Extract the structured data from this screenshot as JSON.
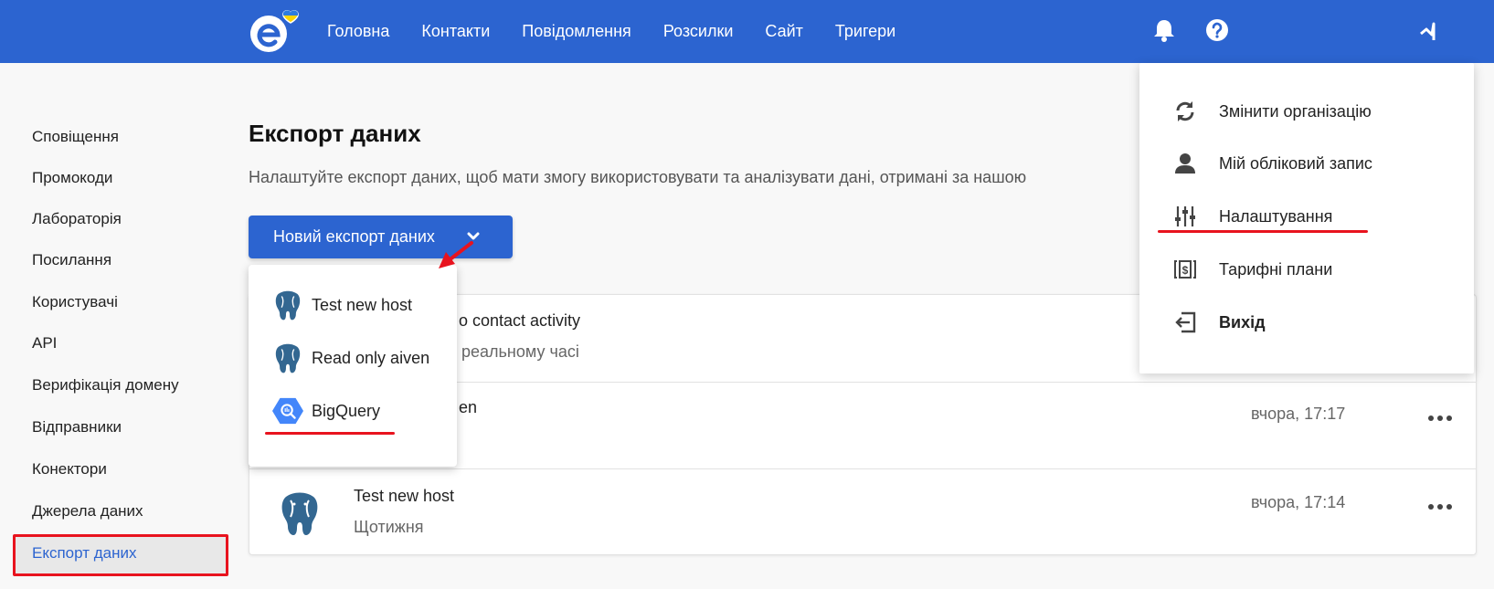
{
  "colors": {
    "brand": "#2c64d0",
    "highlight": "#e8131e",
    "text": "#222222",
    "muted": "#666666"
  },
  "header": {
    "logo_icon": "esputnik-logo-with-heart",
    "nav": [
      "Головна",
      "Контакти",
      "Повідомлення",
      "Розсилки",
      "Сайт",
      "Тригери"
    ],
    "icons": [
      "bell-icon",
      "help-icon",
      "user-menu-icon"
    ]
  },
  "sidebar": {
    "items": [
      "Сповіщення",
      "Промокоди",
      "Лабораторія",
      "Посилання",
      "Користувачі",
      "API",
      "Верифікація домену",
      "Відправники",
      "Конектори",
      "Джерела даних",
      "Експорт даних"
    ],
    "active": "Експорт даних"
  },
  "main": {
    "title": "Експорт даних",
    "description": "Налаштуйте експорт даних, щоб мати змогу використовувати та аналізувати дані, отримані за нашою",
    "new_export_label": "Новий експорт даних"
  },
  "export_dropdown": {
    "items": [
      {
        "label": "Test new host",
        "icon": "postgresql-icon"
      },
      {
        "label": "Read only aiven",
        "icon": "postgresql-icon"
      },
      {
        "label": "BigQuery",
        "icon": "bigquery-icon"
      }
    ]
  },
  "exports": [
    {
      "name": "contact activity",
      "name_prefix_visible": "o ",
      "sub": "реальному часі",
      "time": ""
    },
    {
      "name": "en",
      "sub": "",
      "time": "вчора, 17:17"
    },
    {
      "name": "Test new host",
      "sub": "Щотижня",
      "time": "вчора, 17:14",
      "icon": "postgresql-icon"
    }
  ],
  "user_menu": {
    "items": [
      {
        "label": "Змінити організацію",
        "icon": "sync-icon"
      },
      {
        "label": "Мій обліковий запис",
        "icon": "person-icon"
      },
      {
        "label": "Налаштування",
        "icon": "sliders-icon"
      },
      {
        "label": "Тарифні плани",
        "icon": "pricing-icon"
      },
      {
        "label": "Вихід",
        "icon": "logout-icon"
      }
    ]
  }
}
